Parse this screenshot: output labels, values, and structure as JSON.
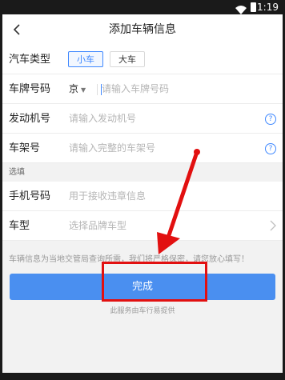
{
  "statusbar": {
    "time": "11:19"
  },
  "header": {
    "title": "添加车辆信息"
  },
  "form": {
    "car_type": {
      "label": "汽车类型",
      "options": [
        "小车",
        "大车"
      ],
      "selected": "小车"
    },
    "plate": {
      "label": "车牌号码",
      "province": "京",
      "placeholder": "请输入车牌号码"
    },
    "engine": {
      "label": "发动机号",
      "placeholder": "请输入发动机号"
    },
    "frame": {
      "label": "车架号",
      "placeholder": "请输入完整的车架号"
    },
    "optional_section": "选填",
    "phone": {
      "label": "手机号码",
      "placeholder": "用于接收违章信息"
    },
    "model": {
      "label": "车型",
      "placeholder": "选择品牌车型"
    }
  },
  "notice": "车辆信息为当地交管局查询所需，我们将严格保密，请您放心填写！",
  "submit_label": "完成",
  "provider": "此服务由车行易提供",
  "colors": {
    "accent": "#4a8ff0",
    "highlight": "#e21010"
  },
  "icons": {
    "back": "chevron-left-icon",
    "help": "question-circle-icon",
    "chevron": "chevron-right-icon",
    "wifi": "wifi-icon",
    "battery": "battery-icon"
  }
}
